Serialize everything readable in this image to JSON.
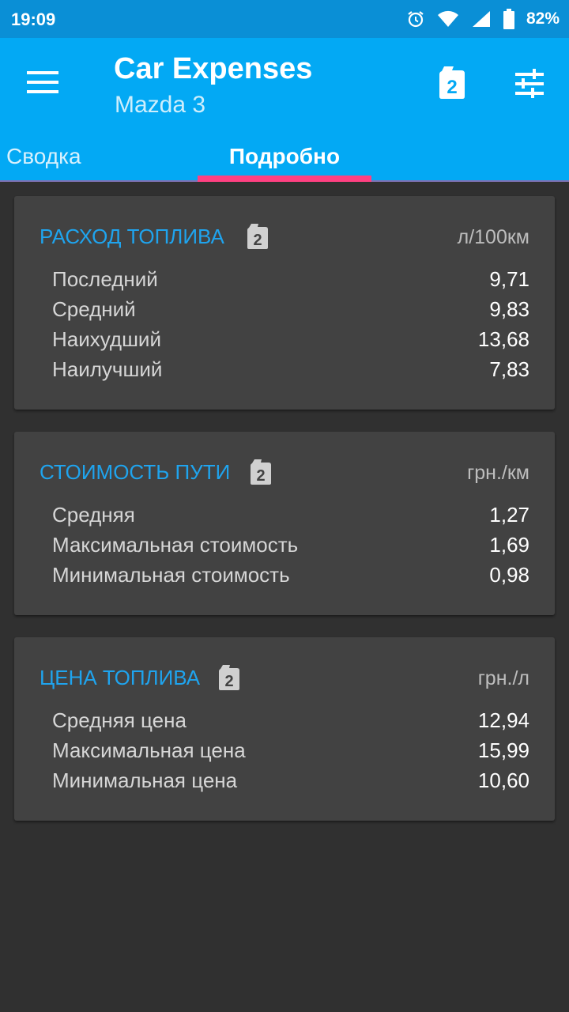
{
  "status": {
    "time": "19:09",
    "battery": "82%"
  },
  "appbar": {
    "title": "Car Expenses",
    "subtitle": "Mazda 3",
    "icons": [
      "menu-icon",
      "fuel-canister-icon",
      "tune-icon"
    ],
    "fuel_badge": "2"
  },
  "tabs": [
    {
      "label": "Сводка",
      "active": false
    },
    {
      "label": "Подробно",
      "active": true
    }
  ],
  "cards": [
    {
      "title": "РАСХОД ТОПЛИВА",
      "badge": "2",
      "unit": "л/100км",
      "rows": [
        {
          "label": "Последний",
          "value": "9,71"
        },
        {
          "label": "Средний",
          "value": "9,83"
        },
        {
          "label": "Наихудший",
          "value": "13,68"
        },
        {
          "label": "Наилучший",
          "value": "7,83"
        }
      ]
    },
    {
      "title": "СТОИМОСТЬ ПУТИ",
      "badge": "2",
      "unit": "грн./км",
      "rows": [
        {
          "label": "Средняя",
          "value": "1,27"
        },
        {
          "label": "Максимальная стоимость",
          "value": "1,69"
        },
        {
          "label": "Минимальная стоимость",
          "value": "0,98"
        }
      ]
    },
    {
      "title": "ЦЕНА ТОПЛИВА",
      "badge": "2",
      "unit": "грн./л",
      "rows": [
        {
          "label": "Средняя цена",
          "value": "12,94"
        },
        {
          "label": "Максимальная цена",
          "value": "15,99"
        },
        {
          "label": "Минимальная цена",
          "value": "10,60"
        }
      ]
    }
  ],
  "colors": {
    "primary": "#03a9f4",
    "status_bar": "#0a8fd6",
    "accent": "#ff4081",
    "background": "#303030",
    "card": "#424242",
    "card_title": "#1fa4ee"
  }
}
